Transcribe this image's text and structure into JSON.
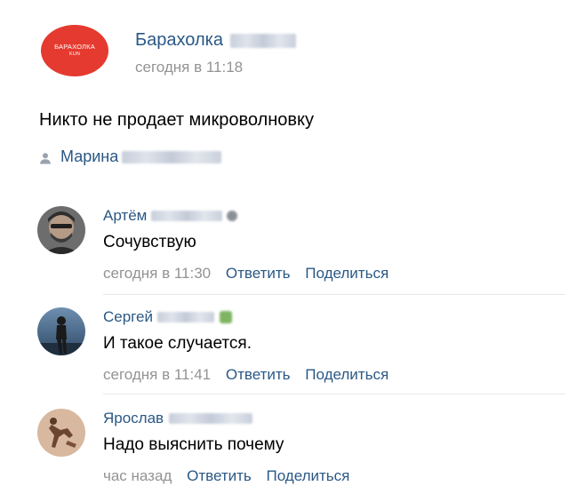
{
  "post": {
    "group_logo_text": "БАРАХОЛКА",
    "group_logo_subtext": "KUN",
    "group_name": "Барахолка",
    "time": "сегодня в 11:18",
    "text": "Никто не продает микроволновку",
    "author": "Марина"
  },
  "comments": [
    {
      "name": "Артём",
      "text": "Сочувствую",
      "time": "сегодня в 11:30",
      "reply": "Ответить",
      "share": "Поделиться"
    },
    {
      "name": "Сергей",
      "text": "И такое случается.",
      "time": "сегодня в 11:41",
      "reply": "Ответить",
      "share": "Поделиться"
    },
    {
      "name": "Ярослав",
      "text": "Надо выяснить почему",
      "time": "час назад",
      "reply": "Ответить",
      "share": "Поделиться"
    }
  ],
  "colors": {
    "link": "#2a5885",
    "meta": "#939393",
    "logo": "#e53a2f",
    "divider": "#e7e8ec"
  }
}
